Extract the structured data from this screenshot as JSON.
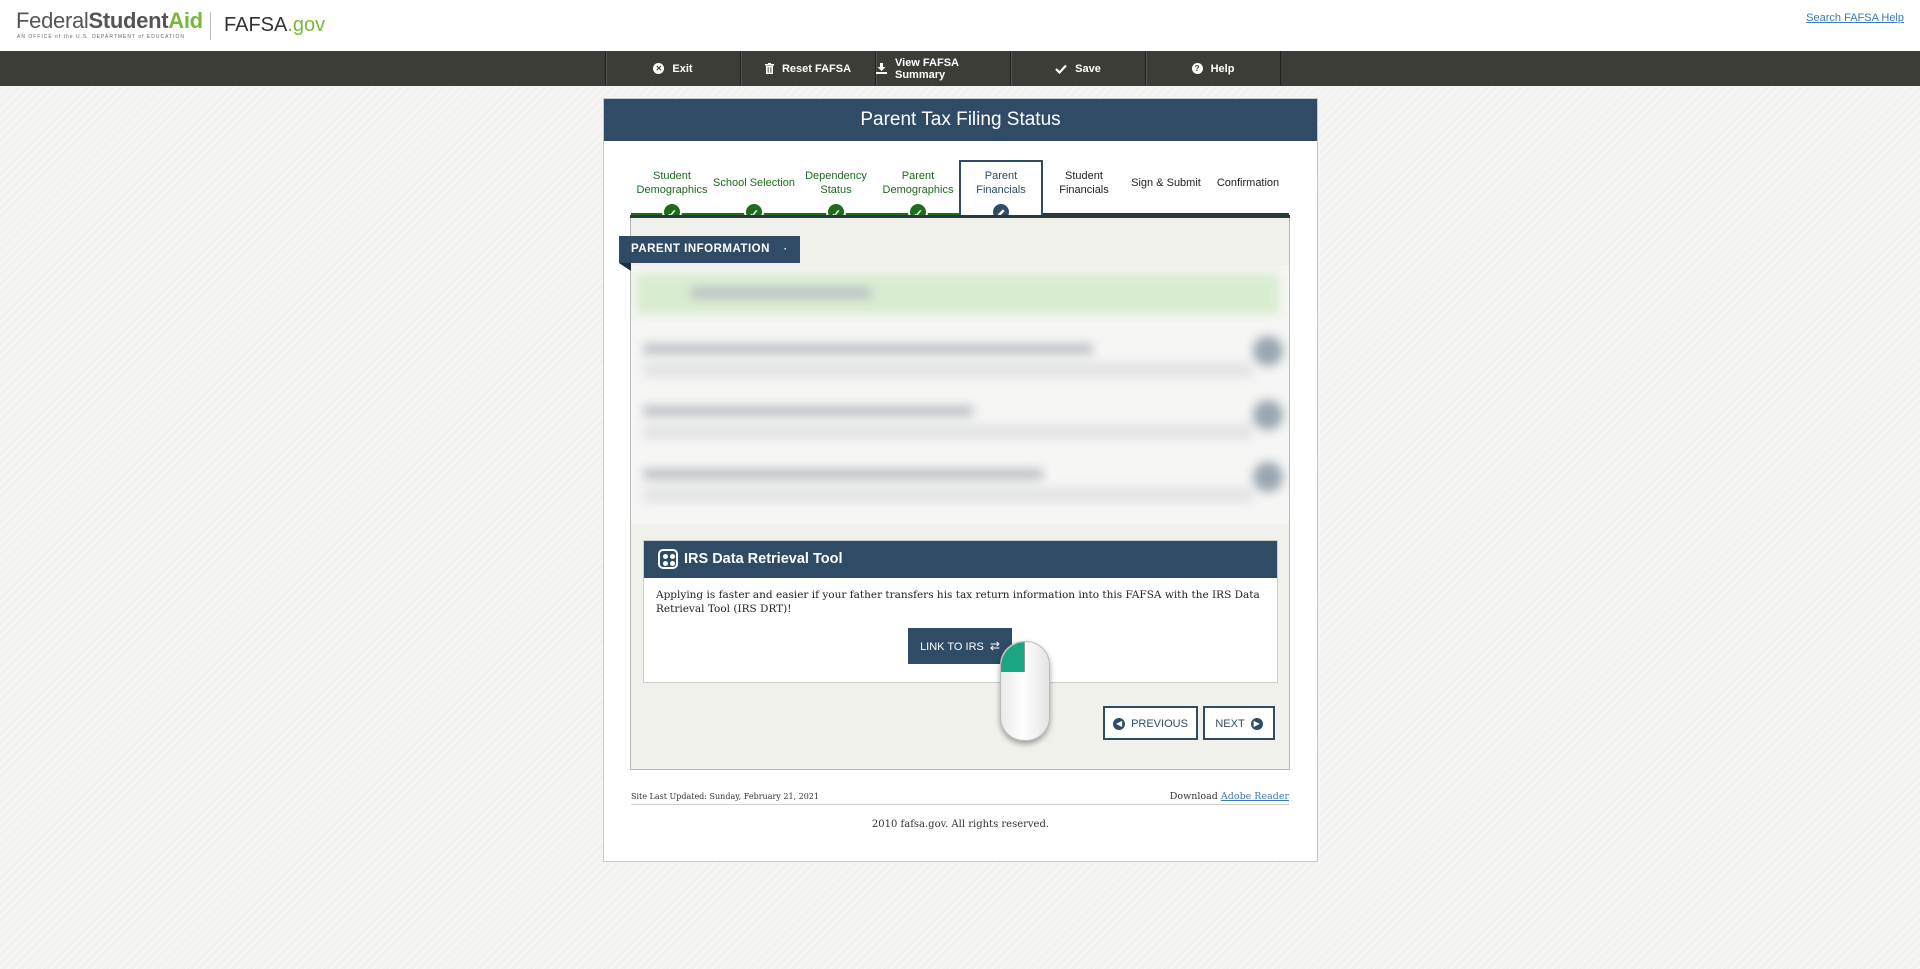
{
  "header": {
    "logo_federal": "Federal",
    "logo_student": "Student",
    "logo_aid": "Aid",
    "logo_subtitle": "AN OFFICE of the U.S. DEPARTMENT of EDUCATION",
    "logo_fafsa": "FAFSA",
    "logo_gov": ".gov",
    "search_help": "Search FAFSA Help"
  },
  "toolbar": {
    "exit": "Exit",
    "reset": "Reset FAFSA",
    "summary": "View FAFSA Summary",
    "save": "Save",
    "help": "Help"
  },
  "page": {
    "title": "Parent Tax Filing Status"
  },
  "progress": {
    "steps": [
      {
        "label": "Student Demographics",
        "state": "done"
      },
      {
        "label": "School Selection",
        "state": "done"
      },
      {
        "label": "Dependency Status",
        "state": "done"
      },
      {
        "label": "Parent Demographics",
        "state": "done"
      },
      {
        "label": "Parent Financials",
        "state": "active"
      },
      {
        "label": "Student Financials",
        "state": "todo"
      },
      {
        "label": "Sign & Submit",
        "state": "todo"
      },
      {
        "label": "Confirmation",
        "state": "todo"
      }
    ]
  },
  "section": {
    "tab_label": "PARENT INFORMATION",
    "tab_dot": "·"
  },
  "irs_tool": {
    "title": "IRS Data Retrieval Tool",
    "body": "Applying is faster and easier if your father transfers his tax return information into this FAFSA with the IRS Data Retrieval Tool (IRS DRT)!",
    "link_label": "LINK TO IRS",
    "link_icon": "⇄"
  },
  "nav": {
    "previous": "PREVIOUS",
    "next": "NEXT"
  },
  "footer": {
    "updated": "Site Last Updated: Sunday, February 21, 2021",
    "download_prefix": "Download",
    "download_link": "Adobe Reader",
    "copyright": "2010 fafsa.gov. All rights reserved."
  },
  "colors": {
    "navy": "#2f4b66",
    "green": "#1d6b1d",
    "toolbar": "#3d3d38",
    "brand_green": "#7ab83b"
  }
}
